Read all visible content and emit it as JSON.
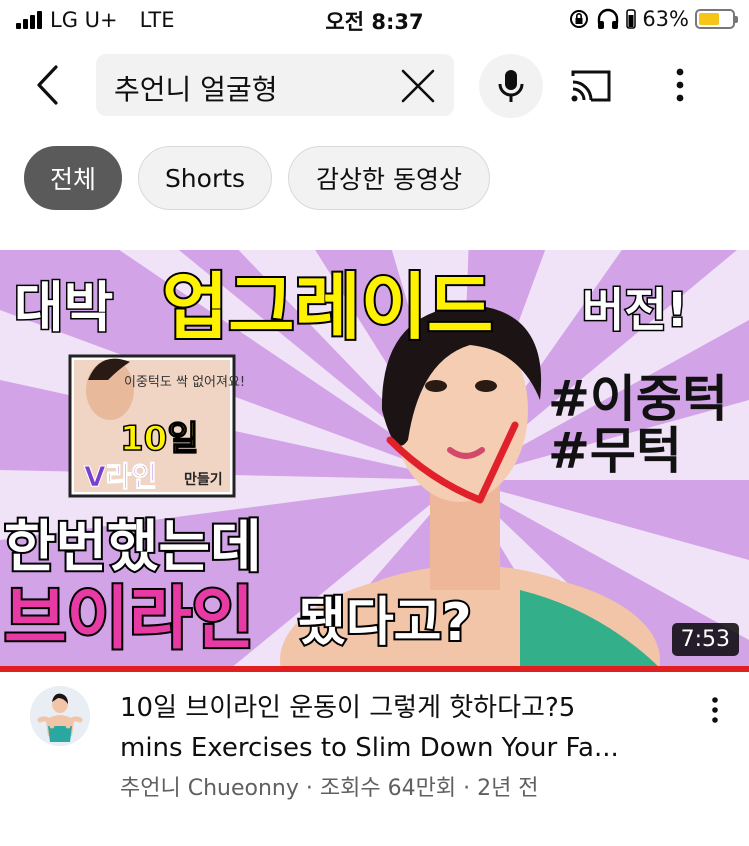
{
  "status_bar": {
    "carrier": "LG U+",
    "network": "LTE",
    "time": "오전 8:37",
    "battery_percent": "63%",
    "battery_level": 0.63
  },
  "search": {
    "query": "추언니 얼굴형"
  },
  "chips": [
    {
      "label": "전체",
      "active": true
    },
    {
      "label": "Shorts",
      "active": false
    },
    {
      "label": "감상한 동영상",
      "active": false
    }
  ],
  "video": {
    "thumbnail_text": {
      "top_left": "대박",
      "top_highlight": "업그레이드",
      "top_right": "버전!",
      "inset_caption": "이중턱도 싹 없어져요!",
      "inset_days": "10일",
      "inset_vline": "V라인",
      "inset_make": "만들기",
      "hashtag1": "#이중턱",
      "hashtag2": "#무턱",
      "bottom_line1": "한번했는데",
      "bottom_pink": "브이라인",
      "bottom_rest": "됐다고?"
    },
    "duration": "7:53",
    "title_line1": "10일 브이라인 운동이 그렇게 핫하다고?5",
    "title_line2": "mins Exercises to Slim Down Your Fa...",
    "channel": "추언니 Chueonny",
    "views": "조회수 64만회",
    "age": "2년 전",
    "separator": "·"
  },
  "colors": {
    "accent_red": "#e02020",
    "chip_active_bg": "#5a5a5a",
    "chip_bg": "#f2f2f2",
    "thumbnail_bg": "#d3a3e8",
    "thumbnail_yellow": "#fff200",
    "thumbnail_pink": "#e83aa5",
    "battery_yellow": "#f5c518"
  },
  "icons": {
    "back": "chevron-left-icon",
    "clear": "close-icon",
    "mic": "microphone-icon",
    "cast": "cast-icon",
    "more": "more-vertical-icon"
  }
}
